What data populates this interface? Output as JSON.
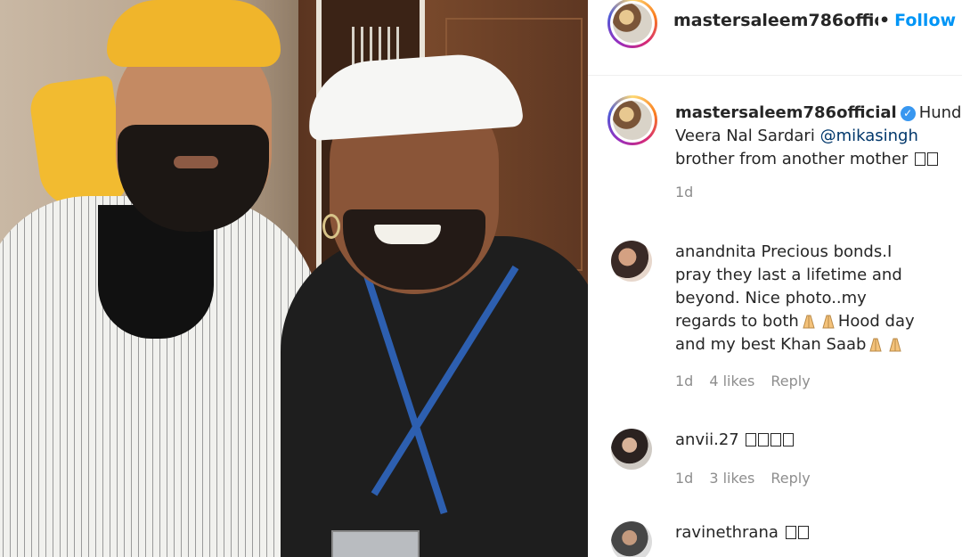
{
  "post": {
    "author": "mastersaleem786official",
    "follow_label": "Follow",
    "separator": "•",
    "caption_lines": [
      "Hund",
      "Veera Nal Sardari ",
      "brother from another mother"
    ],
    "caption_mention": "@mikasingh",
    "caption_time": "1d"
  },
  "comments": [
    {
      "username": "anandnita",
      "lines": [
        "Precious bonds.I",
        "pray they last a lifetime and",
        "beyond. Nice photo..my",
        "regards to both",
        "Hood day",
        "and my best Khan Saab"
      ],
      "time": "1d",
      "likes": "4 likes",
      "reply": "Reply"
    },
    {
      "username": "anvii.27",
      "time": "1d",
      "likes": "3 likes",
      "reply": "Reply"
    },
    {
      "username": "ravinethrana"
    }
  ],
  "colors": {
    "follow_blue": "#0095f6",
    "verified_blue": "#3897f0",
    "meta_gray": "#8e8e8e"
  },
  "icons": [
    "verified-badge-icon",
    "folded-hands-emoji-icon",
    "missing-glyph-icon"
  ]
}
